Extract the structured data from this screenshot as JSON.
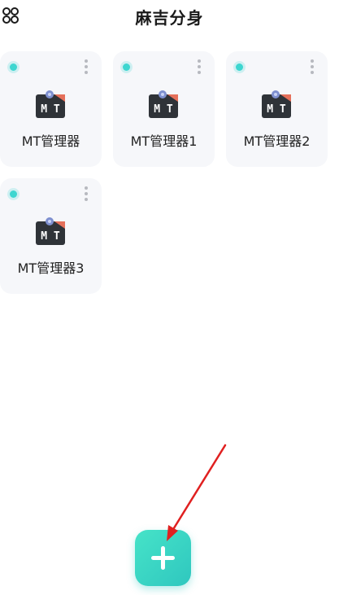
{
  "header": {
    "title": "麻吉分身",
    "menu_icon": "grid-menu-icon"
  },
  "apps": [
    {
      "label": "MT管理器",
      "status": "active",
      "icon": "mt-manager-icon"
    },
    {
      "label": "MT管理器1",
      "status": "active",
      "icon": "mt-manager-icon"
    },
    {
      "label": "MT管理器2",
      "status": "active",
      "icon": "mt-manager-icon"
    },
    {
      "label": "MT管理器3",
      "status": "active",
      "icon": "mt-manager-icon"
    }
  ],
  "fab": {
    "icon": "plus-icon"
  },
  "annotation": {
    "icon": "red-arrow-icon",
    "color": "#e02020"
  },
  "colors": {
    "accent": "#3dd6d0",
    "card_bg": "#f6f7fa"
  }
}
